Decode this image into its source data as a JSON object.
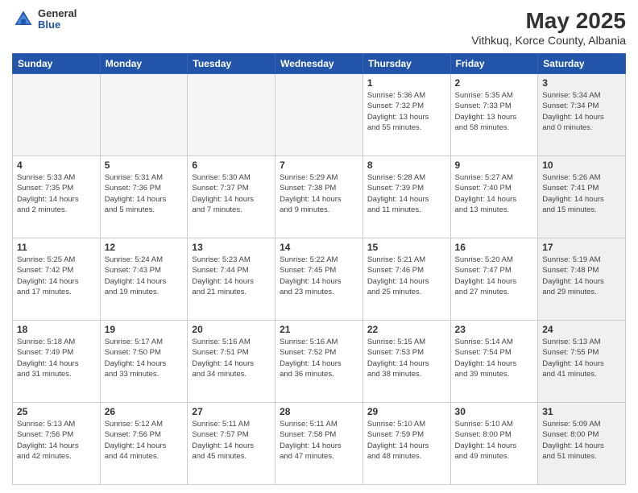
{
  "header": {
    "logo": {
      "general": "General",
      "blue": "Blue"
    },
    "title": "May 2025",
    "subtitle": "Vithkuq, Korce County, Albania"
  },
  "days_of_week": [
    "Sunday",
    "Monday",
    "Tuesday",
    "Wednesday",
    "Thursday",
    "Friday",
    "Saturday"
  ],
  "weeks": [
    [
      {
        "day": "",
        "info": "",
        "empty": true
      },
      {
        "day": "",
        "info": "",
        "empty": true
      },
      {
        "day": "",
        "info": "",
        "empty": true
      },
      {
        "day": "",
        "info": "",
        "empty": true
      },
      {
        "day": "1",
        "info": "Sunrise: 5:36 AM\nSunset: 7:32 PM\nDaylight: 13 hours\nand 55 minutes."
      },
      {
        "day": "2",
        "info": "Sunrise: 5:35 AM\nSunset: 7:33 PM\nDaylight: 13 hours\nand 58 minutes."
      },
      {
        "day": "3",
        "info": "Sunrise: 5:34 AM\nSunset: 7:34 PM\nDaylight: 14 hours\nand 0 minutes.",
        "shaded": true
      }
    ],
    [
      {
        "day": "4",
        "info": "Sunrise: 5:33 AM\nSunset: 7:35 PM\nDaylight: 14 hours\nand 2 minutes."
      },
      {
        "day": "5",
        "info": "Sunrise: 5:31 AM\nSunset: 7:36 PM\nDaylight: 14 hours\nand 5 minutes."
      },
      {
        "day": "6",
        "info": "Sunrise: 5:30 AM\nSunset: 7:37 PM\nDaylight: 14 hours\nand 7 minutes."
      },
      {
        "day": "7",
        "info": "Sunrise: 5:29 AM\nSunset: 7:38 PM\nDaylight: 14 hours\nand 9 minutes."
      },
      {
        "day": "8",
        "info": "Sunrise: 5:28 AM\nSunset: 7:39 PM\nDaylight: 14 hours\nand 11 minutes."
      },
      {
        "day": "9",
        "info": "Sunrise: 5:27 AM\nSunset: 7:40 PM\nDaylight: 14 hours\nand 13 minutes."
      },
      {
        "day": "10",
        "info": "Sunrise: 5:26 AM\nSunset: 7:41 PM\nDaylight: 14 hours\nand 15 minutes.",
        "shaded": true
      }
    ],
    [
      {
        "day": "11",
        "info": "Sunrise: 5:25 AM\nSunset: 7:42 PM\nDaylight: 14 hours\nand 17 minutes."
      },
      {
        "day": "12",
        "info": "Sunrise: 5:24 AM\nSunset: 7:43 PM\nDaylight: 14 hours\nand 19 minutes."
      },
      {
        "day": "13",
        "info": "Sunrise: 5:23 AM\nSunset: 7:44 PM\nDaylight: 14 hours\nand 21 minutes."
      },
      {
        "day": "14",
        "info": "Sunrise: 5:22 AM\nSunset: 7:45 PM\nDaylight: 14 hours\nand 23 minutes."
      },
      {
        "day": "15",
        "info": "Sunrise: 5:21 AM\nSunset: 7:46 PM\nDaylight: 14 hours\nand 25 minutes."
      },
      {
        "day": "16",
        "info": "Sunrise: 5:20 AM\nSunset: 7:47 PM\nDaylight: 14 hours\nand 27 minutes."
      },
      {
        "day": "17",
        "info": "Sunrise: 5:19 AM\nSunset: 7:48 PM\nDaylight: 14 hours\nand 29 minutes.",
        "shaded": true
      }
    ],
    [
      {
        "day": "18",
        "info": "Sunrise: 5:18 AM\nSunset: 7:49 PM\nDaylight: 14 hours\nand 31 minutes."
      },
      {
        "day": "19",
        "info": "Sunrise: 5:17 AM\nSunset: 7:50 PM\nDaylight: 14 hours\nand 33 minutes."
      },
      {
        "day": "20",
        "info": "Sunrise: 5:16 AM\nSunset: 7:51 PM\nDaylight: 14 hours\nand 34 minutes."
      },
      {
        "day": "21",
        "info": "Sunrise: 5:16 AM\nSunset: 7:52 PM\nDaylight: 14 hours\nand 36 minutes."
      },
      {
        "day": "22",
        "info": "Sunrise: 5:15 AM\nSunset: 7:53 PM\nDaylight: 14 hours\nand 38 minutes."
      },
      {
        "day": "23",
        "info": "Sunrise: 5:14 AM\nSunset: 7:54 PM\nDaylight: 14 hours\nand 39 minutes."
      },
      {
        "day": "24",
        "info": "Sunrise: 5:13 AM\nSunset: 7:55 PM\nDaylight: 14 hours\nand 41 minutes.",
        "shaded": true
      }
    ],
    [
      {
        "day": "25",
        "info": "Sunrise: 5:13 AM\nSunset: 7:56 PM\nDaylight: 14 hours\nand 42 minutes."
      },
      {
        "day": "26",
        "info": "Sunrise: 5:12 AM\nSunset: 7:56 PM\nDaylight: 14 hours\nand 44 minutes."
      },
      {
        "day": "27",
        "info": "Sunrise: 5:11 AM\nSunset: 7:57 PM\nDaylight: 14 hours\nand 45 minutes."
      },
      {
        "day": "28",
        "info": "Sunrise: 5:11 AM\nSunset: 7:58 PM\nDaylight: 14 hours\nand 47 minutes."
      },
      {
        "day": "29",
        "info": "Sunrise: 5:10 AM\nSunset: 7:59 PM\nDaylight: 14 hours\nand 48 minutes."
      },
      {
        "day": "30",
        "info": "Sunrise: 5:10 AM\nSunset: 8:00 PM\nDaylight: 14 hours\nand 49 minutes."
      },
      {
        "day": "31",
        "info": "Sunrise: 5:09 AM\nSunset: 8:00 PM\nDaylight: 14 hours\nand 51 minutes.",
        "shaded": true
      }
    ]
  ]
}
